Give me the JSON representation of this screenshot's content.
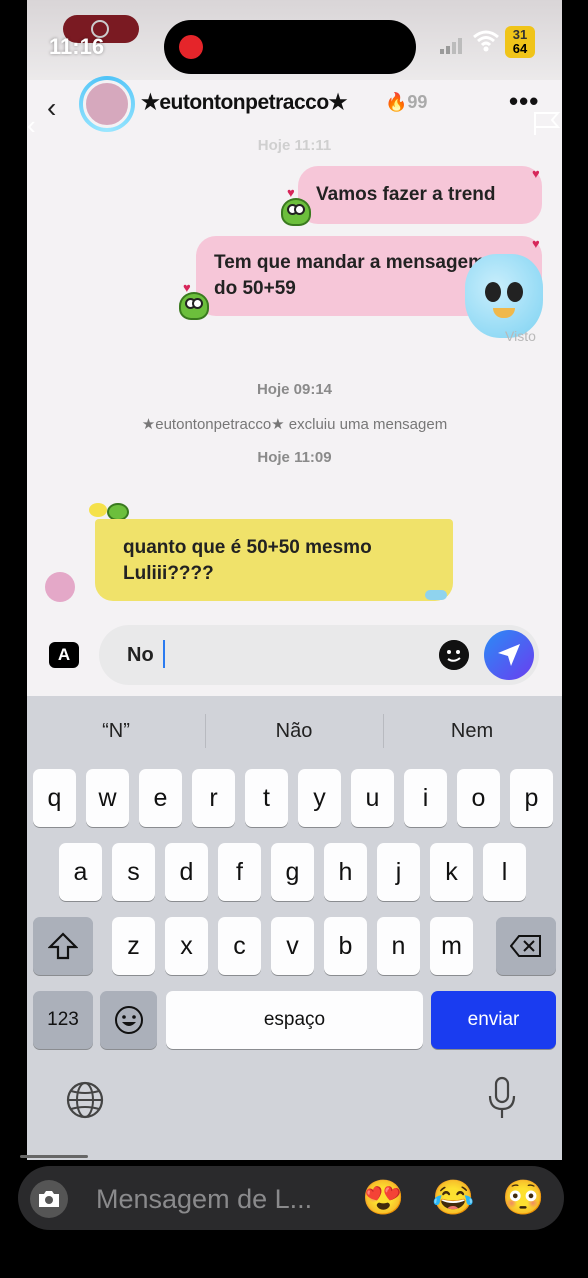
{
  "status_bar": {
    "time": "11:16",
    "battery_top": "31",
    "battery_bottom": "64"
  },
  "header": {
    "username": "★eutontonpetracco★",
    "streak": "99"
  },
  "messages": {
    "timestamp_top": "Hoje 11:11",
    "outgoing_1": "Vamos fazer a trend",
    "outgoing_2_line1": "Tem que mandar a mensagem",
    "outgoing_2_line2": "do 50+59",
    "seen": "Visto",
    "timestamp_2": "Hoje 09:14",
    "system": "★eutontonpetracco★ excluiu uma mensagem",
    "timestamp_3": "Hoje 11:09",
    "incoming_line1": "quanto que é 50+50 mesmo",
    "incoming_line2": "Luliii????"
  },
  "composer": {
    "left_badge": "A",
    "value": "No"
  },
  "keyboard": {
    "suggestions": [
      "“N”",
      "Não",
      "Nem"
    ],
    "row1": [
      "q",
      "w",
      "e",
      "r",
      "t",
      "y",
      "u",
      "i",
      "o",
      "p"
    ],
    "row2": [
      "a",
      "s",
      "d",
      "f",
      "g",
      "h",
      "j",
      "k",
      "l"
    ],
    "row3": [
      "z",
      "x",
      "c",
      "v",
      "b",
      "n",
      "m"
    ],
    "numbers_key": "123",
    "space_key": "espaço",
    "send_key": "enviar"
  },
  "reply_bar": {
    "placeholder": "Mensagem de L...",
    "emojis": [
      "😍",
      "😂",
      "😳"
    ]
  },
  "colors": {
    "outgoing_bubble": "#f6c6d8",
    "incoming_bubble": "#f0e26a",
    "send_key": "#1a3cf0",
    "accent": "#2a8cf5"
  }
}
